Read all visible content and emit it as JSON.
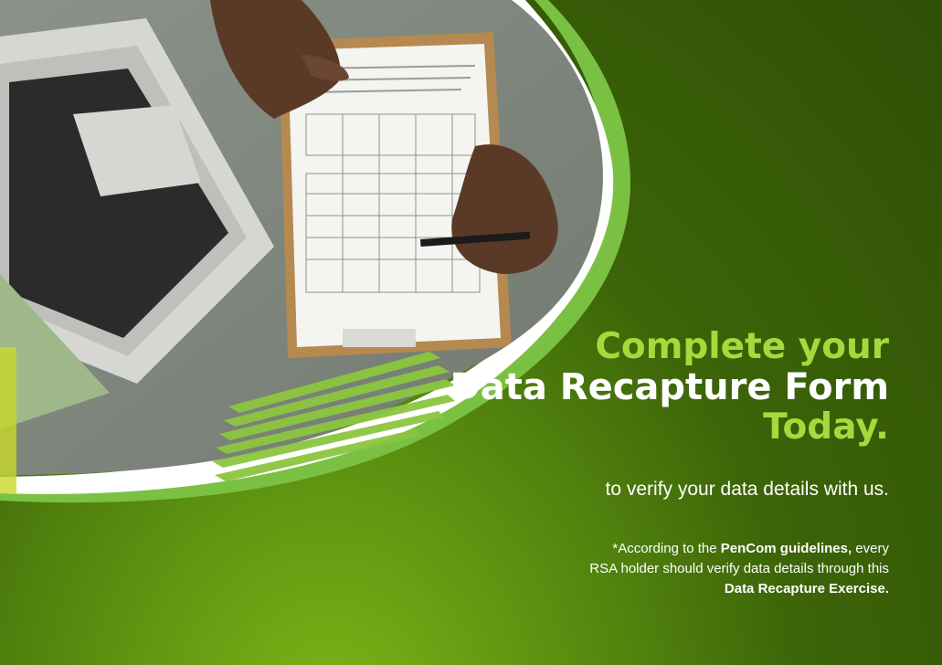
{
  "headline": {
    "line1": "Complete your",
    "line2": "Data Recapture Form",
    "line3": "Today."
  },
  "subline": "to verify your data details with us.",
  "note": {
    "part1": "*According to the ",
    "bold1": "PenCom guidelines,",
    "part2": " every",
    "line2": "RSA holder should verify data details through this",
    "bold2": "Data Recapture Exercise."
  },
  "colors": {
    "accent": "#a6d93b",
    "background": "#3c6408",
    "swoosh": "#7ac143",
    "white": "#ffffff"
  },
  "icons": {
    "photo": "desk-photo-laptop-clipboard"
  }
}
